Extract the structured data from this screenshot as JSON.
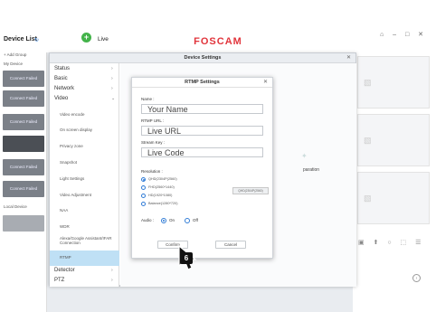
{
  "topbar": {
    "device_list_title": "Device List",
    "add_symbol": "+",
    "live_tab": "Live",
    "brand": "FOSCAM",
    "window_controls": "⌂ – □ ✕"
  },
  "left_panel": {
    "add_group": "+ Add Group",
    "my_device": "My Device",
    "camera_status": "Connect Failed",
    "local_device": "Local Device"
  },
  "device_settings": {
    "title": "Device Settings",
    "close": "✕",
    "nav": {
      "status": "Status",
      "basic": "Basic",
      "network": "Network",
      "video": "Video",
      "detector": "Detector",
      "ptz": "PTZ"
    },
    "video_items": [
      "Video encode",
      "On screen display",
      "Privacy zone",
      "Snapshot",
      "Light Settings",
      "Video Adjustment",
      "NAA",
      "WDR",
      "Alexa/Google Assistant/IFAR Connection",
      "RTMP"
    ],
    "chev_right": "›",
    "chev_down": "⌄",
    "main_fragment": "paration"
  },
  "rtmp": {
    "title": "RTMP Settings",
    "close": "✕",
    "name_label": "Name :",
    "name_placeholder": "Your Name",
    "url_label": "RTMP URL :",
    "url_placeholder": "Live URL",
    "key_label": "Stream Key :",
    "key_placeholder": "Live Code",
    "resolution_label": "Resolution :",
    "resolutions": [
      "QHD(2304P(2560)",
      "FHD(2560*1440)",
      "HD(1920*1080)",
      "Balance(1280*720)"
    ],
    "resolution_value": "QHD(2304P(2560)",
    "audio_label": "Audio :",
    "audio_on": "On",
    "audio_off": "Off",
    "confirm": "Confirm",
    "cancel": "Cancel"
  },
  "annotation": {
    "step_number": "6"
  },
  "right_grid": {
    "bottom_icons": "▣ ⬆ ○ ⬚ ☰",
    "side_btn": "›"
  }
}
